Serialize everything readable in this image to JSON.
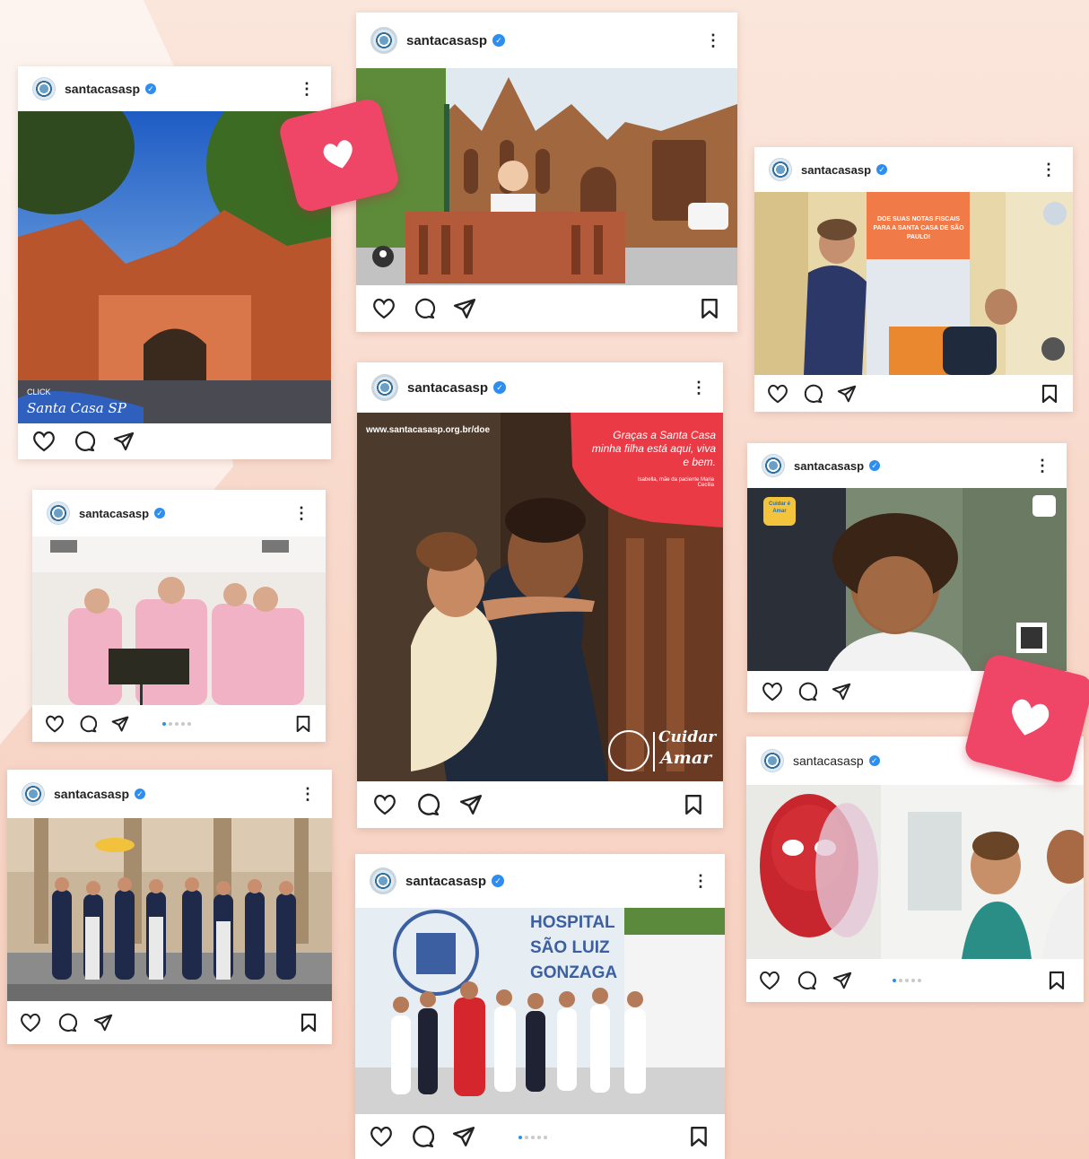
{
  "account": {
    "username": "santacasasp",
    "verified_mark": "✓",
    "more_glyph": "⋮"
  },
  "icons": {
    "like": "heart-outline-icon",
    "comment": "comment-bubble-icon",
    "share": "paper-plane-icon",
    "save": "bookmark-icon",
    "badge": "heart-filled-icon"
  },
  "colors": {
    "badge": "#ef4567",
    "verified": "#2e8ef0",
    "background": "#f8d9cb"
  },
  "posts": {
    "p1": {
      "overlay_line1": "CLICK",
      "overlay_line2": "Santa Casa SP"
    },
    "p5": {
      "url": "www.santacasasp.org.br/doe",
      "quote": "Graças a Santa Casa minha filha está aqui, viva e bem.",
      "attribution": "Isabella, mãe da paciente Maria Cecília",
      "brand_line1": "Cuidar",
      "brand_line2": "Amar"
    },
    "p6": {
      "banner": "DOE SUAS NOTAS FISCAIS PARA A SANTA CASA DE SÃO PAULO!"
    },
    "p7": {
      "logo": "Cuidar é Amar"
    },
    "p9": {
      "line1": "HOSPITAL",
      "line2": "SÃO LUIZ",
      "line3": "GONZAGA"
    }
  }
}
